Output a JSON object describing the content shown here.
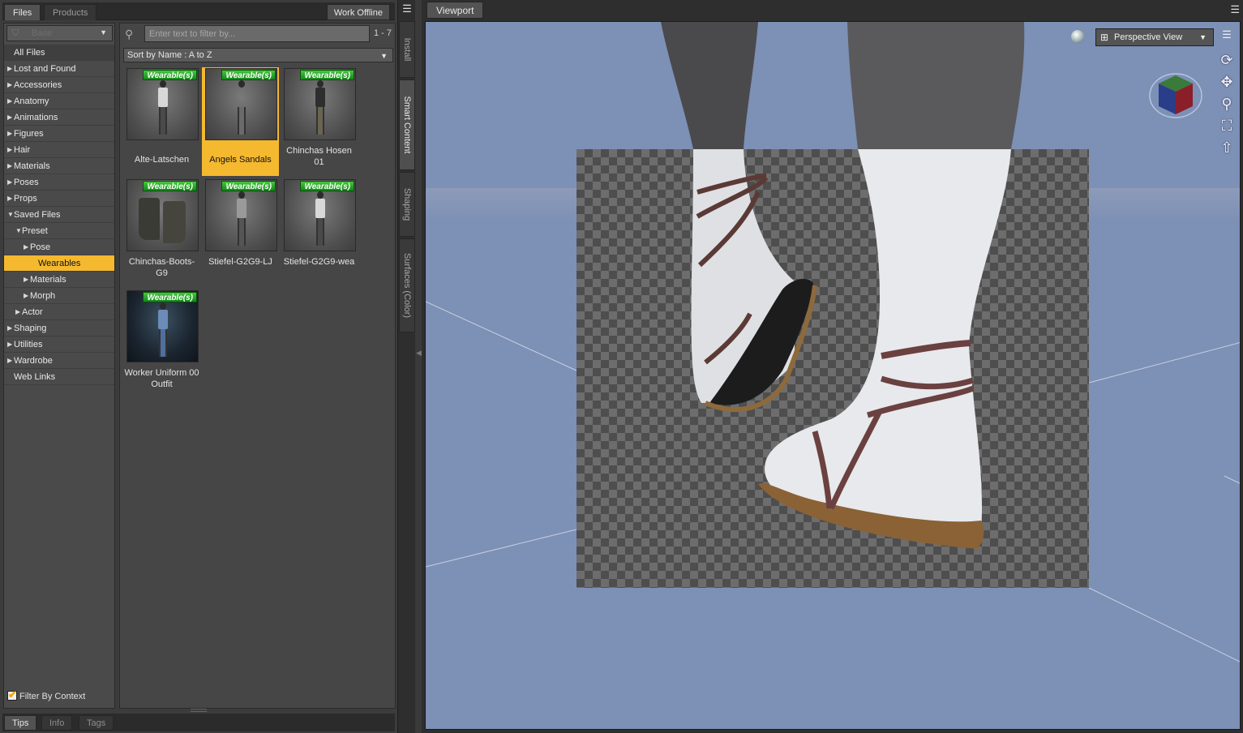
{
  "left_tabs": {
    "files": "Files",
    "products": "Products",
    "work_offline": "Work Offline"
  },
  "filter": {
    "label": "Base"
  },
  "categories": [
    {
      "label": "All Files",
      "level": 0,
      "arrow": ""
    },
    {
      "label": "Lost and Found",
      "level": 0,
      "arrow": "▶"
    },
    {
      "label": "Accessories",
      "level": 0,
      "arrow": "▶"
    },
    {
      "label": "Anatomy",
      "level": 0,
      "arrow": "▶"
    },
    {
      "label": "Animations",
      "level": 0,
      "arrow": "▶"
    },
    {
      "label": "Figures",
      "level": 0,
      "arrow": "▶"
    },
    {
      "label": "Hair",
      "level": 0,
      "arrow": "▶"
    },
    {
      "label": "Materials",
      "level": 0,
      "arrow": "▶"
    },
    {
      "label": "Poses",
      "level": 0,
      "arrow": "▶"
    },
    {
      "label": "Props",
      "level": 0,
      "arrow": "▶"
    },
    {
      "label": "Saved Files",
      "level": 0,
      "arrow": "▼"
    },
    {
      "label": "Preset",
      "level": 1,
      "arrow": "▼"
    },
    {
      "label": "Pose",
      "level": 2,
      "arrow": "▶"
    },
    {
      "label": "Wearables",
      "level": 3,
      "arrow": "",
      "selected": true
    },
    {
      "label": "Materials",
      "level": 2,
      "arrow": "▶"
    },
    {
      "label": "Morph",
      "level": 2,
      "arrow": "▶"
    },
    {
      "label": "Actor",
      "level": 1,
      "arrow": "▶"
    },
    {
      "label": "Shaping",
      "level": 0,
      "arrow": "▶"
    },
    {
      "label": "Utilities",
      "level": 0,
      "arrow": "▶"
    },
    {
      "label": "Wardrobe",
      "level": 0,
      "arrow": "▶"
    },
    {
      "label": "Web Links",
      "level": 0,
      "arrow": ""
    }
  ],
  "filter_by_context": {
    "label": "Filter By Context",
    "checked": true
  },
  "search": {
    "placeholder": "Enter text to filter by...",
    "count": "1 - 7"
  },
  "sort": {
    "label": "Sort by Name : A to Z"
  },
  "badge_label": "Wearable(s)",
  "items": [
    {
      "label": "Alte-Latschen",
      "thumb": "figure-white-shirt"
    },
    {
      "label": "Angels Sandals",
      "thumb": "legs-sandals",
      "selected": true
    },
    {
      "label": "Chinchas Hosen 01",
      "thumb": "figure-pants"
    },
    {
      "label": "Chinchas-Boots-G9",
      "thumb": "boots"
    },
    {
      "label": "Stiefel-G2G9-LJ",
      "thumb": "figure-boots"
    },
    {
      "label": "Stiefel-G2G9-wea",
      "thumb": "figure-boots-white"
    },
    {
      "label": "Worker Uniform 00 Outfit",
      "thumb": "worker-uniform"
    }
  ],
  "bottom_tabs": {
    "tips": "Tips",
    "info": "Info",
    "tags": "Tags"
  },
  "vertical_tabs": {
    "install": "Install",
    "smart_content": "Smart Content",
    "shaping": "Shaping",
    "surfaces": "Surfaces (Color)"
  },
  "viewport": {
    "tab": "Viewport",
    "view": "Perspective View"
  },
  "colors": {
    "accent": "#f4b92f",
    "badge": "#1f9a22",
    "scene": "#7d90b6"
  }
}
